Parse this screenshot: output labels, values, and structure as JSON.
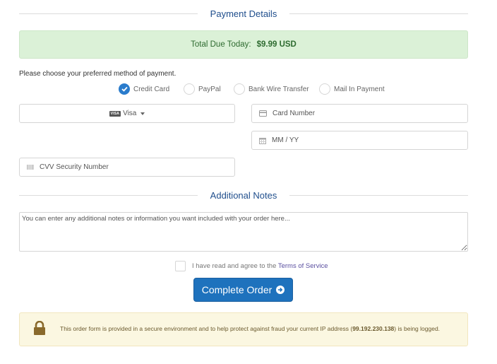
{
  "payment_section": {
    "title": "Payment Details",
    "total_label": "Total Due Today:",
    "total_amount": "$9.99 USD",
    "choose_text": "Please choose your preferred method of payment.",
    "methods": [
      {
        "label": "Credit Card",
        "checked": true
      },
      {
        "label": "PayPal",
        "checked": false
      },
      {
        "label": "Bank Wire Transfer",
        "checked": false
      },
      {
        "label": "Mail In Payment",
        "checked": false
      }
    ],
    "card_type": {
      "selected": "Visa",
      "badge": "VISA",
      "icon": "visa-card-icon"
    },
    "card_number": {
      "placeholder": "Card Number",
      "value": "",
      "icon": "credit-card-icon"
    },
    "expiry": {
      "placeholder": "MM / YY",
      "value": "",
      "icon": "calendar-icon"
    },
    "cvv": {
      "placeholder": "CVV Security Number",
      "value": "",
      "icon": "barcode-icon"
    }
  },
  "notes_section": {
    "title": "Additional Notes",
    "placeholder": "You can enter any additional notes or information you want included with your order here...",
    "value": ""
  },
  "tos": {
    "prefix": "I have read and agree to the",
    "link": "Terms of Service",
    "checked": false
  },
  "submit": {
    "label": "Complete Order",
    "icon": "arrow-circle-right-icon"
  },
  "security_notice": {
    "text_before": "This order form is provided in a secure environment and to help protect against fraud your current IP address (",
    "ip": "99.192.230.138",
    "text_after": ") is being logged.",
    "icon": "lock-icon"
  },
  "colors": {
    "accent": "#1e72bd",
    "heading": "#1f4e8c",
    "success_bg": "#dbf1d7",
    "success_text": "#2e6b30",
    "warning_bg": "#fbf7e1",
    "lock": "#8a6a2c"
  }
}
